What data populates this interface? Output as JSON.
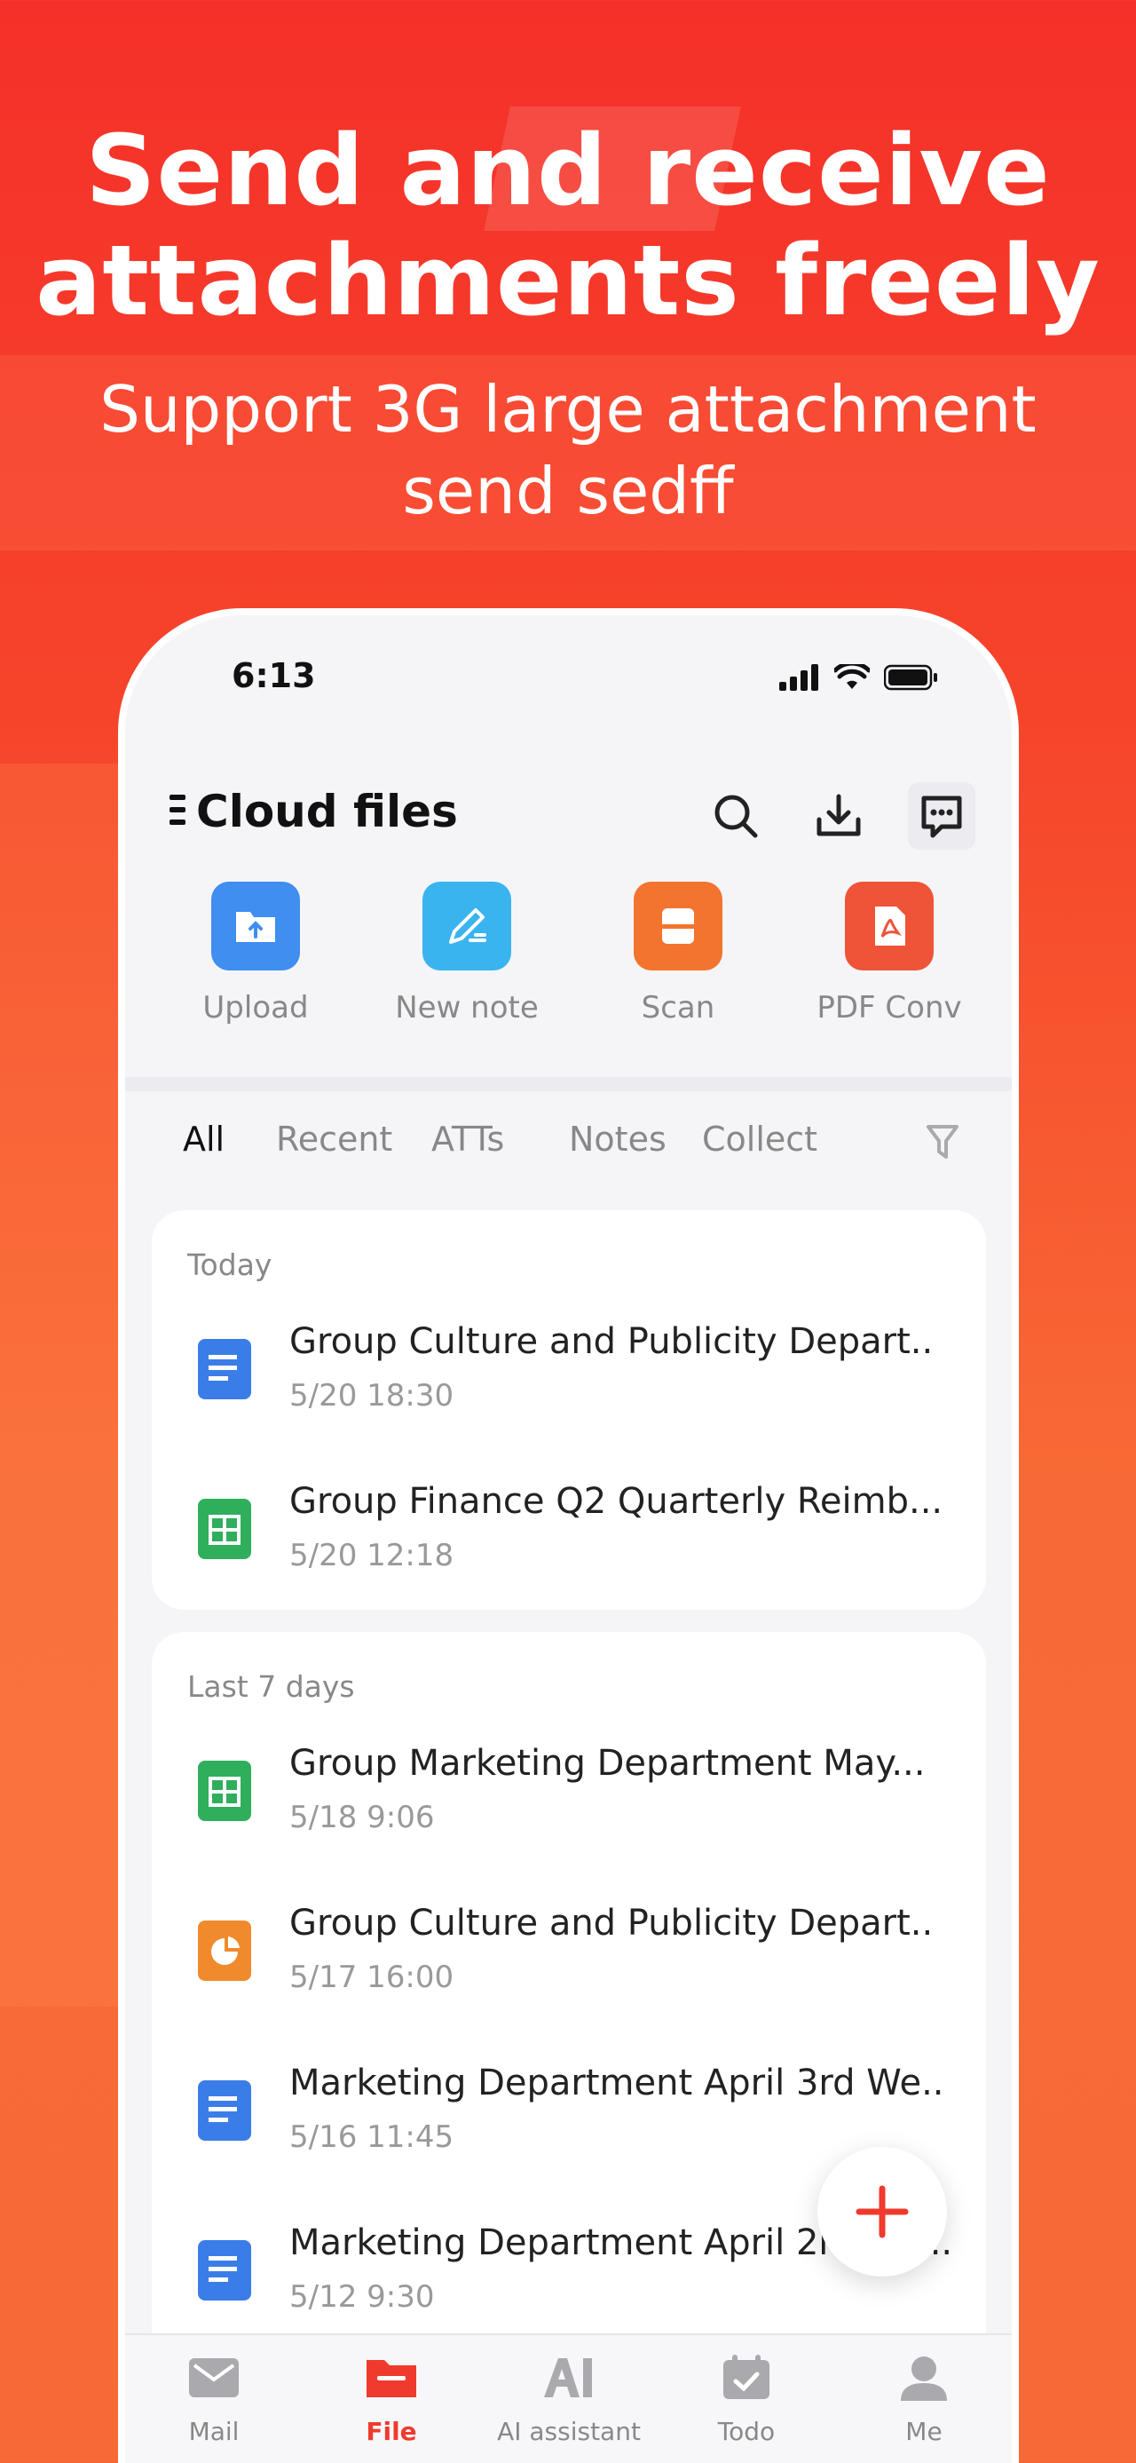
{
  "hero": {
    "title_line1": "Send and receive",
    "title_line2": "attachments freely",
    "subtitle_line1": "Support 3G large attachment",
    "subtitle_line2": "send sedff"
  },
  "status_bar": {
    "time": "6:13"
  },
  "header": {
    "title": "Cloud files"
  },
  "quick_actions": [
    {
      "label": "Upload",
      "icon": "upload-icon",
      "color": "#3f8ef0"
    },
    {
      "label": "New note",
      "icon": "pen-icon",
      "color": "#3ab4ef"
    },
    {
      "label": "Scan",
      "icon": "scan-icon",
      "color": "#f2742e"
    },
    {
      "label": "PDF Conv",
      "icon": "pdf-icon",
      "color": "#ef5338"
    }
  ],
  "tabs": [
    "All",
    "Recent",
    "ATTs",
    "Notes",
    "Collect"
  ],
  "active_tab": "All",
  "sections": [
    {
      "label": "Today",
      "files": [
        {
          "name": "Group Culture and Publicity Depart..",
          "date": "5/20 18:30",
          "type": "doc"
        },
        {
          "name": "Group Finance Q2 Quarterly Reimb...",
          "date": "5/20 12:18",
          "type": "sheet"
        }
      ]
    },
    {
      "label": "Last 7 days",
      "files": [
        {
          "name": "Group Marketing Department May...",
          "date": "5/18 9:06",
          "type": "sheet"
        },
        {
          "name": "Group Culture and Publicity Depart..",
          "date": "5/17 16:00",
          "type": "slides"
        },
        {
          "name": "Marketing Department April 3rd We..",
          "date": "5/16 11:45",
          "type": "doc"
        },
        {
          "name": "Marketing Department April 2nd We..",
          "date": "5/12 9:30",
          "type": "doc"
        }
      ]
    }
  ],
  "tabbar": [
    {
      "label": "Mail",
      "icon": "mail-icon"
    },
    {
      "label": "File",
      "icon": "folder-icon",
      "active": true
    },
    {
      "label": "AI assistant",
      "icon": "ai-icon"
    },
    {
      "label": "Todo",
      "icon": "todo-icon"
    },
    {
      "label": "Me",
      "icon": "person-icon"
    }
  ],
  "colors": {
    "accent": "#f03a2e",
    "doc": "#3b7de8",
    "sheet": "#2fae5b",
    "slides": "#f08a2c"
  }
}
